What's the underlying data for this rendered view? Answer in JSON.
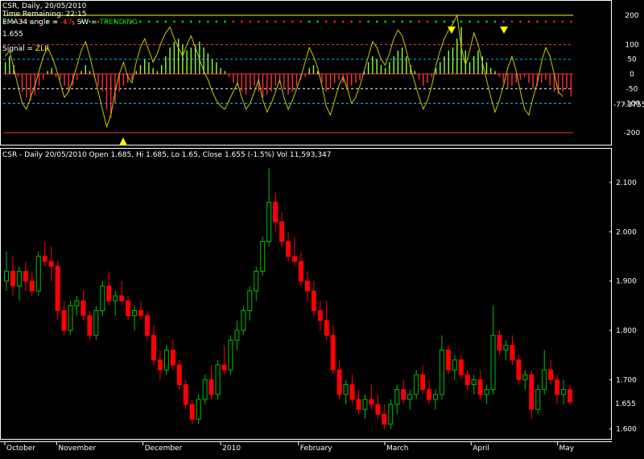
{
  "indicator_panel": {
    "title": "CSR, Daily, 20/05/2010",
    "time_remaining": "Time Remaining: 22:15",
    "ema_prefix": "EMA34 angle = ",
    "ema_value": "-17",
    "sw_text": ", SW = ",
    "sw_value": "TRENDING",
    "price": "1.655",
    "signal_prefix": "Signal = ",
    "signal_value": "ZLR",
    "current_value": "-77.3755",
    "y_ticks": [
      "200",
      "100",
      "50",
      "0",
      "-50",
      "-100",
      "-200"
    ],
    "levels": [
      200,
      100,
      50,
      0,
      -50,
      -100,
      -200
    ]
  },
  "price_panel": {
    "header": "CSR - Daily 20/05/2010 Open 1.685, Hi 1.685, Lo 1.65, Close 1.655 (-1.5%) Vol 11,593,347",
    "current_price": "1.655",
    "y_ticks": [
      "2.100",
      "2.000",
      "1.900",
      "1.800",
      "1.700",
      "1.600"
    ]
  },
  "x_axis": {
    "months": [
      "October",
      "November",
      "December",
      "2010",
      "February",
      "March",
      "April",
      "May"
    ]
  },
  "colors": {
    "background": "#000000",
    "up": "#00c000",
    "down": "#ff0000",
    "histogram_up": "#90ff40",
    "histogram_down": "#ff3030",
    "cci_line": "#c8c800",
    "signal_marker": "#ffff00",
    "grid": "#ffffff"
  },
  "chart_data": [
    {
      "type": "bar",
      "name": "indicator",
      "ylim": [
        -230,
        230
      ],
      "values": [
        40,
        60,
        30,
        -10,
        -60,
        -80,
        -90,
        -70,
        -40,
        -20,
        10,
        20,
        -10,
        -20,
        -40,
        -60,
        -40,
        -20,
        10,
        30,
        10,
        -10,
        -40,
        -60,
        -120,
        -150,
        -100,
        -60,
        -40,
        -30,
        -20,
        10,
        30,
        50,
        40,
        20,
        10,
        30,
        60,
        90,
        110,
        120,
        100,
        80,
        90,
        100,
        110,
        90,
        70,
        50,
        40,
        20,
        10,
        -10,
        -30,
        -40,
        -60,
        -70,
        -50,
        -40,
        -60,
        -80,
        -70,
        -60,
        -40,
        -30,
        -50,
        -70,
        -60,
        -40,
        -20,
        -10,
        20,
        30,
        10,
        -30,
        -60,
        -50,
        -30,
        -20,
        -30,
        -50,
        -40,
        -30,
        -20,
        10,
        40,
        60,
        50,
        30,
        20,
        40,
        60,
        80,
        90,
        60,
        30,
        10,
        -20,
        -40,
        -30,
        -10,
        20,
        40,
        60,
        80,
        90,
        120,
        160,
        80,
        40,
        60,
        80,
        60,
        40,
        20,
        10,
        -10,
        -30,
        -50,
        -40,
        -30,
        -20,
        -10,
        -30,
        -50,
        -40,
        -30,
        -20,
        -40,
        -60,
        -70,
        -60,
        -50,
        -77
      ],
      "cci": [
        60,
        80,
        20,
        -40,
        -100,
        -120,
        -80,
        -40,
        10,
        60,
        90,
        60,
        20,
        -30,
        -80,
        -60,
        -20,
        30,
        80,
        110,
        60,
        0,
        -60,
        -120,
        -180,
        -140,
        -60,
        0,
        40,
        -10,
        -30,
        40,
        90,
        120,
        80,
        40,
        70,
        110,
        140,
        160,
        120,
        90,
        60,
        100,
        130,
        90,
        50,
        10,
        -20,
        -60,
        -90,
        -110,
        -120,
        -90,
        -60,
        -30,
        -80,
        -120,
        -100,
        -60,
        -20,
        -90,
        -130,
        -100,
        -60,
        -20,
        -80,
        -120,
        -90,
        -50,
        -10,
        40,
        90,
        60,
        20,
        -40,
        -110,
        -140,
        -90,
        -40,
        -10,
        -50,
        -100,
        -80,
        -40,
        10,
        60,
        110,
        90,
        50,
        30,
        70,
        120,
        150,
        130,
        80,
        20,
        -30,
        -80,
        -120,
        -90,
        -40,
        30,
        80,
        120,
        150,
        170,
        200,
        90,
        30,
        80,
        140,
        100,
        40,
        -20,
        -80,
        -130,
        -90,
        -40,
        20,
        60,
        10,
        -60,
        -120,
        -140,
        -80,
        -30,
        40,
        90,
        60,
        0,
        -60,
        -77
      ]
    },
    {
      "type": "candlestick",
      "name": "price",
      "ylim": [
        1.58,
        2.17
      ],
      "ohlc": [
        [
          1.9,
          1.96,
          1.88,
          1.92
        ],
        [
          1.92,
          1.95,
          1.87,
          1.89
        ],
        [
          1.89,
          1.93,
          1.86,
          1.92
        ],
        [
          1.92,
          1.94,
          1.88,
          1.9
        ],
        [
          1.9,
          1.92,
          1.87,
          1.88
        ],
        [
          1.88,
          1.96,
          1.87,
          1.95
        ],
        [
          1.95,
          1.98,
          1.93,
          1.94
        ],
        [
          1.94,
          1.97,
          1.9,
          1.93
        ],
        [
          1.93,
          1.94,
          1.82,
          1.84
        ],
        [
          1.84,
          1.86,
          1.79,
          1.8
        ],
        [
          1.8,
          1.86,
          1.79,
          1.85
        ],
        [
          1.85,
          1.87,
          1.83,
          1.86
        ],
        [
          1.86,
          1.88,
          1.82,
          1.83
        ],
        [
          1.83,
          1.84,
          1.78,
          1.79
        ],
        [
          1.79,
          1.85,
          1.78,
          1.84
        ],
        [
          1.84,
          1.9,
          1.83,
          1.89
        ],
        [
          1.89,
          1.92,
          1.85,
          1.86
        ],
        [
          1.86,
          1.88,
          1.83,
          1.87
        ],
        [
          1.87,
          1.9,
          1.85,
          1.86
        ],
        [
          1.86,
          1.87,
          1.82,
          1.83
        ],
        [
          1.83,
          1.85,
          1.8,
          1.84
        ],
        [
          1.84,
          1.86,
          1.82,
          1.83
        ],
        [
          1.83,
          1.84,
          1.78,
          1.79
        ],
        [
          1.79,
          1.81,
          1.73,
          1.74
        ],
        [
          1.74,
          1.76,
          1.7,
          1.72
        ],
        [
          1.72,
          1.77,
          1.71,
          1.76
        ],
        [
          1.76,
          1.78,
          1.72,
          1.73
        ],
        [
          1.73,
          1.74,
          1.68,
          1.69
        ],
        [
          1.69,
          1.7,
          1.64,
          1.65
        ],
        [
          1.65,
          1.66,
          1.61,
          1.62
        ],
        [
          1.62,
          1.67,
          1.61,
          1.66
        ],
        [
          1.66,
          1.71,
          1.65,
          1.7
        ],
        [
          1.7,
          1.73,
          1.66,
          1.67
        ],
        [
          1.67,
          1.74,
          1.66,
          1.73
        ],
        [
          1.73,
          1.77,
          1.71,
          1.72
        ],
        [
          1.72,
          1.79,
          1.71,
          1.78
        ],
        [
          1.78,
          1.82,
          1.76,
          1.8
        ],
        [
          1.8,
          1.85,
          1.79,
          1.84
        ],
        [
          1.84,
          1.89,
          1.82,
          1.88
        ],
        [
          1.88,
          1.93,
          1.86,
          1.92
        ],
        [
          1.92,
          1.99,
          1.91,
          1.98
        ],
        [
          1.98,
          2.13,
          1.97,
          2.06
        ],
        [
          2.06,
          2.08,
          2.0,
          2.02
        ],
        [
          2.02,
          2.04,
          1.97,
          1.98
        ],
        [
          1.98,
          2.0,
          1.94,
          1.95
        ],
        [
          1.95,
          1.99,
          1.93,
          1.94
        ],
        [
          1.94,
          1.96,
          1.89,
          1.9
        ],
        [
          1.9,
          1.92,
          1.86,
          1.88
        ],
        [
          1.88,
          1.9,
          1.83,
          1.84
        ],
        [
          1.84,
          1.86,
          1.8,
          1.82
        ],
        [
          1.82,
          1.86,
          1.78,
          1.79
        ],
        [
          1.79,
          1.81,
          1.71,
          1.72
        ],
        [
          1.72,
          1.74,
          1.66,
          1.67
        ],
        [
          1.67,
          1.7,
          1.65,
          1.69
        ],
        [
          1.69,
          1.71,
          1.65,
          1.66
        ],
        [
          1.66,
          1.68,
          1.63,
          1.64
        ],
        [
          1.64,
          1.67,
          1.62,
          1.66
        ],
        [
          1.66,
          1.69,
          1.64,
          1.65
        ],
        [
          1.65,
          1.67,
          1.62,
          1.63
        ],
        [
          1.63,
          1.65,
          1.6,
          1.61
        ],
        [
          1.61,
          1.66,
          1.6,
          1.65
        ],
        [
          1.65,
          1.69,
          1.63,
          1.68
        ],
        [
          1.68,
          1.7,
          1.65,
          1.66
        ],
        [
          1.66,
          1.68,
          1.64,
          1.67
        ],
        [
          1.67,
          1.72,
          1.66,
          1.71
        ],
        [
          1.71,
          1.73,
          1.67,
          1.68
        ],
        [
          1.68,
          1.7,
          1.65,
          1.66
        ],
        [
          1.66,
          1.68,
          1.64,
          1.67
        ],
        [
          1.67,
          1.79,
          1.66,
          1.76
        ],
        [
          1.76,
          1.77,
          1.71,
          1.72
        ],
        [
          1.72,
          1.75,
          1.7,
          1.74
        ],
        [
          1.74,
          1.75,
          1.7,
          1.71
        ],
        [
          1.71,
          1.72,
          1.68,
          1.69
        ],
        [
          1.69,
          1.71,
          1.67,
          1.7
        ],
        [
          1.7,
          1.72,
          1.66,
          1.67
        ],
        [
          1.67,
          1.69,
          1.65,
          1.68
        ],
        [
          1.68,
          1.85,
          1.67,
          1.79
        ],
        [
          1.79,
          1.8,
          1.75,
          1.76
        ],
        [
          1.76,
          1.78,
          1.74,
          1.77
        ],
        [
          1.77,
          1.79,
          1.73,
          1.74
        ],
        [
          1.74,
          1.75,
          1.69,
          1.7
        ],
        [
          1.7,
          1.72,
          1.68,
          1.71
        ],
        [
          1.71,
          1.72,
          1.62,
          1.64
        ],
        [
          1.64,
          1.69,
          1.63,
          1.68
        ],
        [
          1.68,
          1.76,
          1.67,
          1.72
        ],
        [
          1.72,
          1.74,
          1.69,
          1.7
        ],
        [
          1.7,
          1.71,
          1.65,
          1.67
        ],
        [
          1.67,
          1.7,
          1.65,
          1.68
        ],
        [
          1.68,
          1.69,
          1.65,
          1.655
        ]
      ]
    }
  ]
}
